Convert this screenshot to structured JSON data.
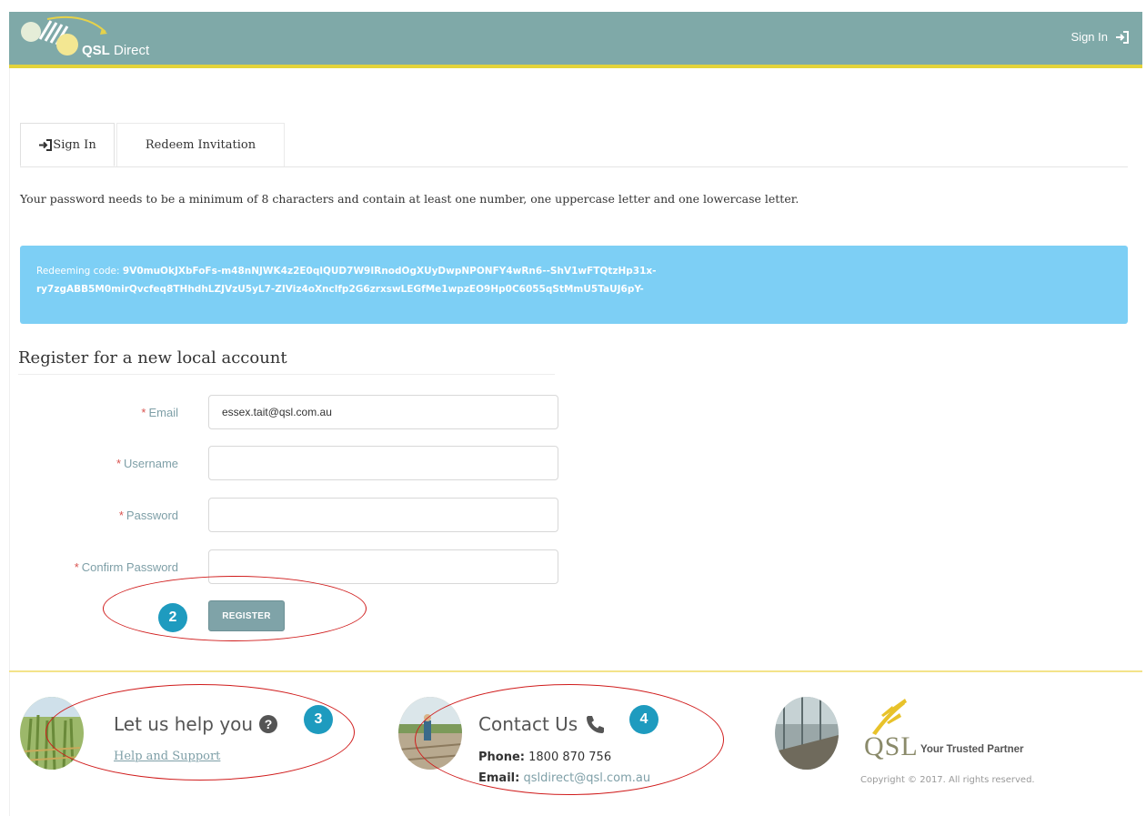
{
  "header": {
    "brand_bold": "QSL",
    "brand_rest": "Direct",
    "signin_label": "Sign In"
  },
  "tabs": [
    {
      "label": "Sign In",
      "active": true
    },
    {
      "label": "Redeem Invitation",
      "active": false
    }
  ],
  "password_note": "Your password needs to be a minimum of 8 characters and contain at least one number, one uppercase letter and one lowercase letter.",
  "redeem": {
    "label": "Redeeming code:",
    "code_line1": "9V0muOkJXbFoFs-m48nNJWK4z2E0qlQUD7W9IRnodOgXUyDwpNPONFY4wRn6--ShV1wFTQtzHp31x-",
    "code_line2": "ry7zgABB5M0mirQvcfeq8THhdhLZJVzU5yL7-ZIViz4oXnclfp2G6zrxswLEGfMe1wpzEO9Hp0C6055qStMmU5TaUJ6pY-"
  },
  "form": {
    "title": "Register for a new local account",
    "required_marker": "*",
    "fields": [
      {
        "label": "Email",
        "value": "essex.tait@qsl.com.au",
        "placeholder": ""
      },
      {
        "label": "Username",
        "value": "",
        "placeholder": ""
      },
      {
        "label": "Password",
        "value": "",
        "placeholder": ""
      },
      {
        "label": "Confirm Password",
        "value": "",
        "placeholder": ""
      }
    ],
    "register_label": "REGISTER"
  },
  "annotations": {
    "badge_register": "2",
    "badge_help": "3",
    "badge_contact": "4",
    "ellipse_color": "#d01c1c",
    "badge_color": "#1e9bbf"
  },
  "footer": {
    "help_title": "Let us help you",
    "help_link": "Help and Support",
    "contact_title": "Contact Us",
    "phone_label": "Phone:",
    "phone_value": "1800 870 756",
    "email_label": "Email:",
    "email_value": "qsldirect@qsl.com.au",
    "logo_text": "QSL",
    "tagline": "Your Trusted Partner",
    "copyright": "Copyright © 2017. All rights reserved."
  },
  "colors": {
    "header_bg": "#7fa9a8",
    "header_accent": "#e3d33a",
    "code_box": "#7dcff5",
    "label": "#7e9fa7",
    "required": "#d9534f"
  },
  "icons": [
    "sign-in-icon",
    "question-circle-icon",
    "phone-icon",
    "qsl-wheat-logo"
  ]
}
